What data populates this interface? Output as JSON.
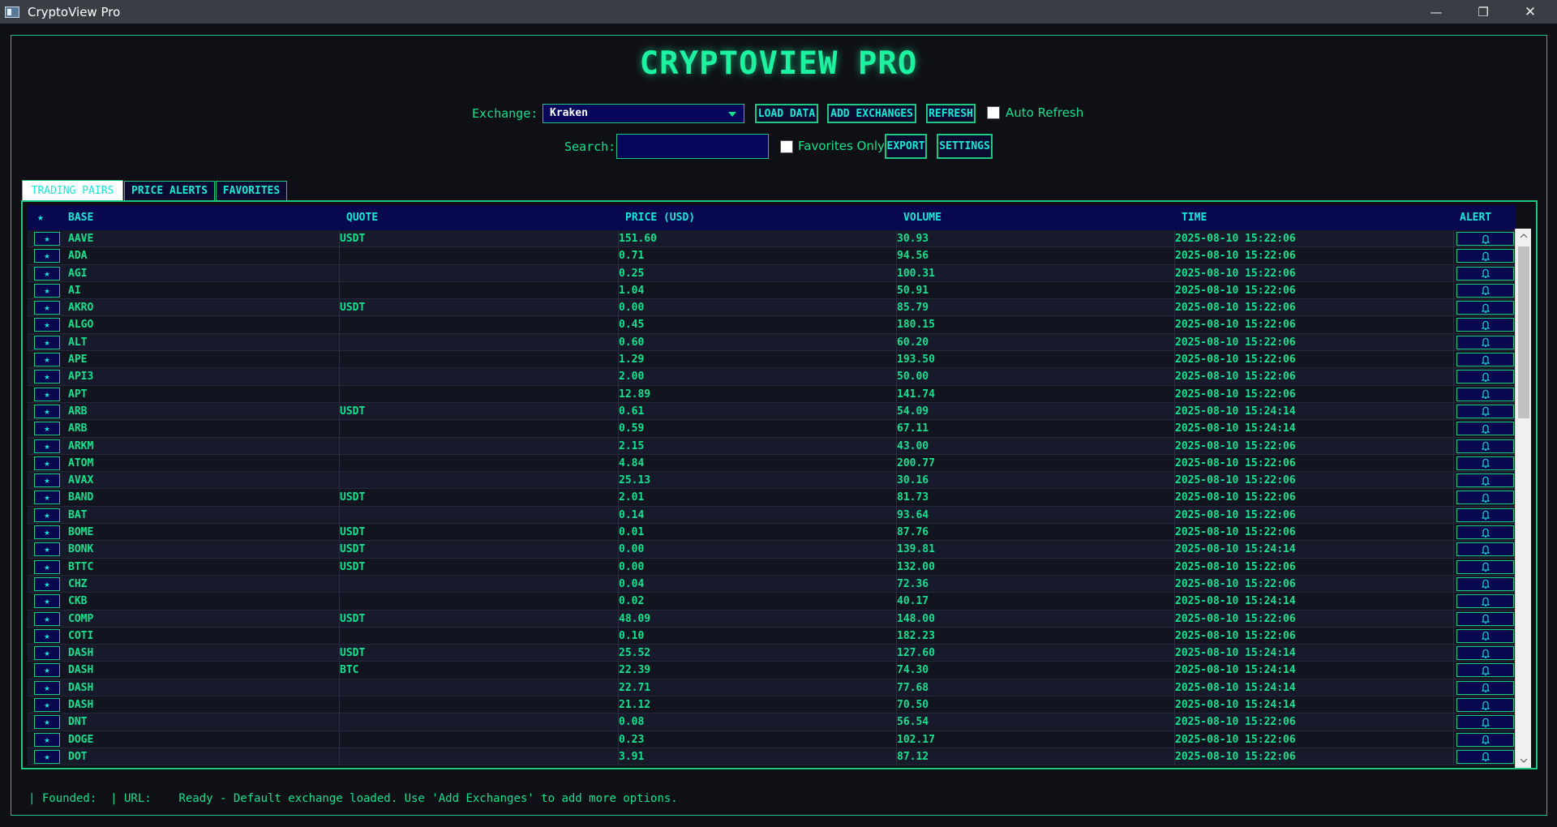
{
  "window": {
    "title": "CryptoView Pro"
  },
  "app_title": "CRYPTOVIEW PRO",
  "toolbar": {
    "exchange_label": "Exchange:",
    "exchange_value": "Kraken",
    "load_data": "LOAD DATA",
    "add_exchanges": "ADD EXCHANGES",
    "refresh": "REFRESH",
    "auto_refresh": "Auto Refresh",
    "search_label": "Search:",
    "search_value": "",
    "favorites_only": "Favorites Only",
    "export": "EXPORT",
    "settings": "SETTINGS"
  },
  "tabs": [
    "TRADING PAIRS",
    "PRICE ALERTS",
    "FAVORITES"
  ],
  "columns": {
    "star": "★",
    "base": "BASE",
    "quote": "QUOTE",
    "price": "PRICE (USD)",
    "volume": "VOLUME",
    "time": "TIME",
    "alert": "ALERT"
  },
  "rows": [
    [
      "AAVE",
      "USDT",
      "151.60",
      "30.93",
      "2025-08-10 15:22:06"
    ],
    [
      "ADA",
      "",
      "0.71",
      "94.56",
      "2025-08-10 15:22:06"
    ],
    [
      "AGI",
      "",
      "0.25",
      "100.31",
      "2025-08-10 15:22:06"
    ],
    [
      "AI",
      "",
      "1.04",
      "50.91",
      "2025-08-10 15:22:06"
    ],
    [
      "AKRO",
      "USDT",
      "0.00",
      "85.79",
      "2025-08-10 15:22:06"
    ],
    [
      "ALGO",
      "",
      "0.45",
      "180.15",
      "2025-08-10 15:22:06"
    ],
    [
      "ALT",
      "",
      "0.60",
      "60.20",
      "2025-08-10 15:22:06"
    ],
    [
      "APE",
      "",
      "1.29",
      "193.50",
      "2025-08-10 15:22:06"
    ],
    [
      "API3",
      "",
      "2.00",
      "50.00",
      "2025-08-10 15:22:06"
    ],
    [
      "APT",
      "",
      "12.89",
      "141.74",
      "2025-08-10 15:22:06"
    ],
    [
      "ARB",
      "USDT",
      "0.61",
      "54.09",
      "2025-08-10 15:24:14"
    ],
    [
      "ARB",
      "",
      "0.59",
      "67.11",
      "2025-08-10 15:24:14"
    ],
    [
      "ARKM",
      "",
      "2.15",
      "43.00",
      "2025-08-10 15:22:06"
    ],
    [
      "ATOM",
      "",
      "4.84",
      "200.77",
      "2025-08-10 15:22:06"
    ],
    [
      "AVAX",
      "",
      "25.13",
      "30.16",
      "2025-08-10 15:22:06"
    ],
    [
      "BAND",
      "USDT",
      "2.01",
      "81.73",
      "2025-08-10 15:22:06"
    ],
    [
      "BAT",
      "",
      "0.14",
      "93.64",
      "2025-08-10 15:22:06"
    ],
    [
      "BOME",
      "USDT",
      "0.01",
      "87.76",
      "2025-08-10 15:22:06"
    ],
    [
      "BONK",
      "USDT",
      "0.00",
      "139.81",
      "2025-08-10 15:24:14"
    ],
    [
      "BTTC",
      "USDT",
      "0.00",
      "132.00",
      "2025-08-10 15:22:06"
    ],
    [
      "CHZ",
      "",
      "0.04",
      "72.36",
      "2025-08-10 15:22:06"
    ],
    [
      "CKB",
      "",
      "0.02",
      "40.17",
      "2025-08-10 15:24:14"
    ],
    [
      "COMP",
      "USDT",
      "48.09",
      "148.00",
      "2025-08-10 15:22:06"
    ],
    [
      "COTI",
      "",
      "0.10",
      "182.23",
      "2025-08-10 15:22:06"
    ],
    [
      "DASH",
      "USDT",
      "25.52",
      "127.60",
      "2025-08-10 15:24:14"
    ],
    [
      "DASH",
      "BTC",
      "22.39",
      "74.30",
      "2025-08-10 15:24:14"
    ],
    [
      "DASH",
      "",
      "22.71",
      "77.68",
      "2025-08-10 15:24:14"
    ],
    [
      "DASH",
      "",
      "21.12",
      "70.50",
      "2025-08-10 15:24:14"
    ],
    [
      "DNT",
      "",
      "0.08",
      "56.54",
      "2025-08-10 15:22:06"
    ],
    [
      "DOGE",
      "",
      "0.23",
      "102.17",
      "2025-08-10 15:22:06"
    ],
    [
      "DOT",
      "",
      "3.91",
      "87.12",
      "2025-08-10 15:22:06"
    ]
  ],
  "status_bar": "| Founded:  | URL:    Ready - Default exchange loaded. Use 'Add Exchanges' to add more options."
}
